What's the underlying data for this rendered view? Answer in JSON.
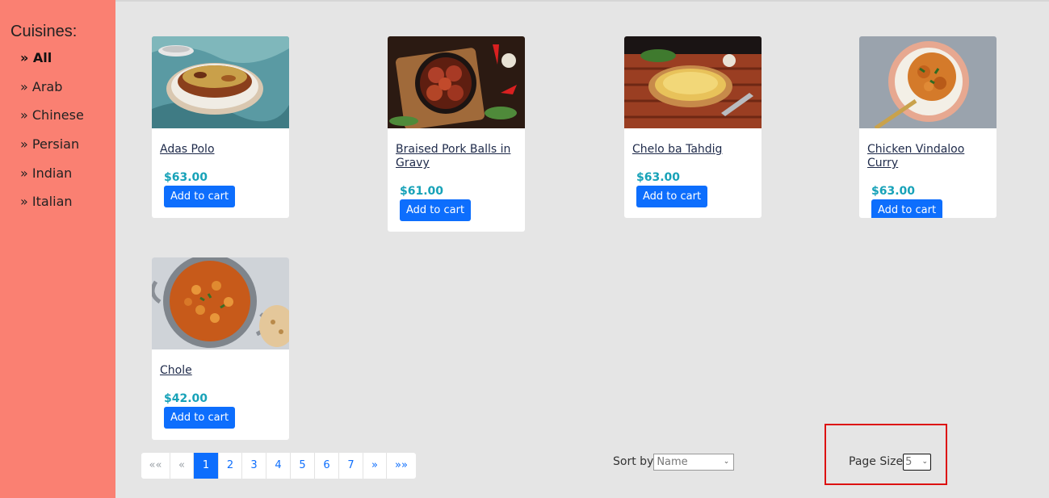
{
  "sidebar": {
    "title": "Cuisines:",
    "items": [
      {
        "label": "» All",
        "active": true
      },
      {
        "label": "» Arab"
      },
      {
        "label": "» Chinese"
      },
      {
        "label": "» Persian"
      },
      {
        "label": "» Indian"
      },
      {
        "label": "» Italian"
      }
    ]
  },
  "products": [
    {
      "name": "Adas Polo",
      "price": "$63.00",
      "button": "Add to cart"
    },
    {
      "name": "Braised Pork Balls in Gravy",
      "price": "$61.00",
      "button": "Add to cart"
    },
    {
      "name": "Chelo ba Tahdig",
      "price": "$63.00",
      "button": "Add to cart"
    },
    {
      "name": "Chicken Vindaloo Curry",
      "price": "$63.00",
      "button": "Add to cart"
    },
    {
      "name": "Chole",
      "price": "$42.00",
      "button": "Add to cart"
    }
  ],
  "pagination": {
    "first": "««",
    "prev": "«",
    "pages": [
      "1",
      "2",
      "3",
      "4",
      "5",
      "6",
      "7"
    ],
    "current": "1",
    "next": "»",
    "last": "»»"
  },
  "sort": {
    "label": "Sort by",
    "value": "Name"
  },
  "page_size": {
    "label": "Page Size",
    "value": "5"
  },
  "colors": {
    "sidebar_bg": "#fa8072",
    "accent": "#0d6efd",
    "price": "#17a2b8",
    "highlight": "#dd1111"
  }
}
